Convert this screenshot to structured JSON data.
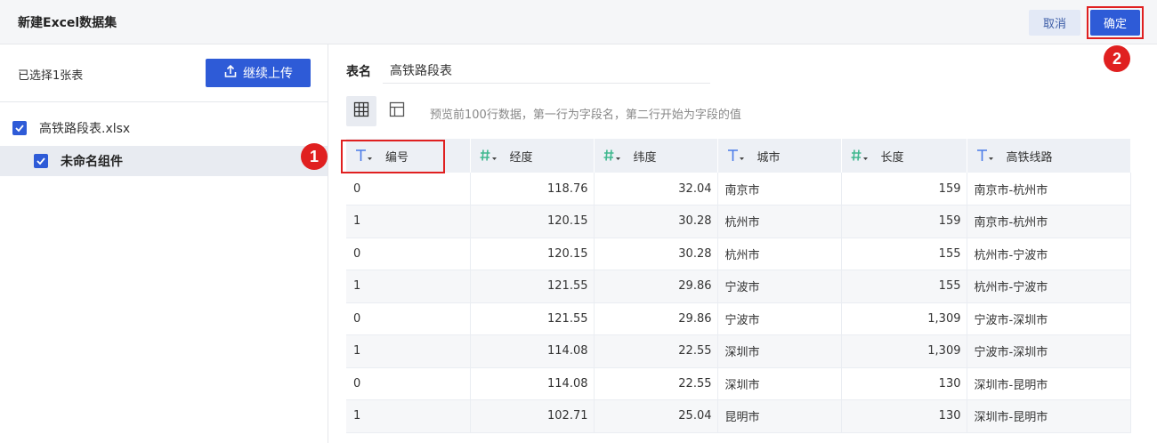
{
  "header": {
    "title": "新建Excel数据集",
    "cancel_label": "取消",
    "ok_label": "确定"
  },
  "left": {
    "selected_count": "已选择1张表",
    "upload_label": "继续上传",
    "file_name": "高铁路段表.xlsx",
    "component_name": "未命名组件"
  },
  "main": {
    "table_name_label": "表名",
    "table_name_value": "高铁路段表",
    "preview_hint": "预览前100行数据，第一行为字段名，第二行开始为字段的值",
    "columns": [
      {
        "label": "编号",
        "type": "text"
      },
      {
        "label": "经度",
        "type": "number"
      },
      {
        "label": "纬度",
        "type": "number"
      },
      {
        "label": "城市",
        "type": "text"
      },
      {
        "label": "长度",
        "type": "number"
      },
      {
        "label": "高铁线路",
        "type": "text"
      }
    ],
    "rows": [
      [
        "0",
        "118.76",
        "32.04",
        "南京市",
        "159",
        "南京市-杭州市"
      ],
      [
        "1",
        "120.15",
        "30.28",
        "杭州市",
        "159",
        "南京市-杭州市"
      ],
      [
        "0",
        "120.15",
        "30.28",
        "杭州市",
        "155",
        "杭州市-宁波市"
      ],
      [
        "1",
        "121.55",
        "29.86",
        "宁波市",
        "155",
        "杭州市-宁波市"
      ],
      [
        "0",
        "121.55",
        "29.86",
        "宁波市",
        "1,309",
        "宁波市-深圳市"
      ],
      [
        "1",
        "114.08",
        "22.55",
        "深圳市",
        "1,309",
        "宁波市-深圳市"
      ],
      [
        "0",
        "114.08",
        "22.55",
        "深圳市",
        "130",
        "深圳市-昆明市"
      ],
      [
        "1",
        "102.71",
        "25.04",
        "昆明市",
        "130",
        "深圳市-昆明市"
      ]
    ]
  },
  "annotations": {
    "badge_1": "1",
    "badge_2": "2"
  },
  "colors": {
    "primary": "#2e5bd7",
    "highlight": "#e02020",
    "text_type_icon": "#4a7be8",
    "number_type_icon": "#3fb88f"
  },
  "icons": {
    "upload": "upload-icon",
    "checkbox": "checkbox-checked-icon",
    "grid_view": "grid-view-icon",
    "card_view": "card-view-icon",
    "text_type": "text-type-icon",
    "number_type": "number-type-icon"
  }
}
